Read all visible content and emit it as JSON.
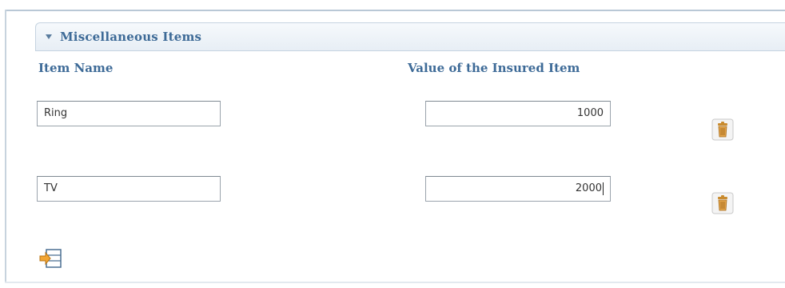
{
  "section": {
    "title": "Miscellaneous Items",
    "expanded_icon": "chevron-down-icon"
  },
  "columns": {
    "item_name": "Item Name",
    "item_value": "Value of the Insured Item"
  },
  "items": [
    {
      "name": "Ring",
      "value": "1000",
      "delete_icon": "trash-icon"
    },
    {
      "name": "TV",
      "value": "2000",
      "delete_icon": "trash-icon"
    }
  ],
  "add_icon": "add-row-icon",
  "colors": {
    "label": "#3d6a97",
    "header_bg": "#e7eef5",
    "icon_orange": "#e3a44a"
  }
}
